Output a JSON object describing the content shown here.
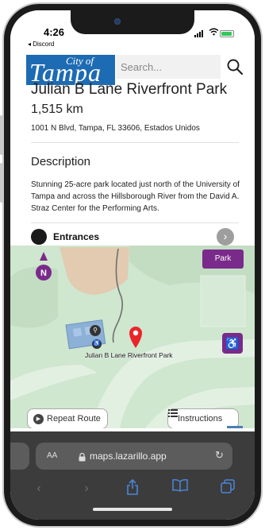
{
  "status": {
    "time": "4:26",
    "back_app": "◂ Discord"
  },
  "header": {
    "logo_city_text": "City of",
    "logo_name_text": "Tampa",
    "search_placeholder": "Search..."
  },
  "place": {
    "name": "Julian B Lane Riverfront Park",
    "distance": "1,515 km",
    "address": "1001 N Blvd, Tampa, FL 33606, Estados Unidos"
  },
  "description": {
    "heading": "Description",
    "text": "Stunning 25-acre park located just north of the University of Tampa and across the Hillsborough River from the David A. Straz Center for the Performing Arts."
  },
  "entrances": {
    "label": "Entrances",
    "arrow": "›"
  },
  "map": {
    "compass_letter": "N",
    "park_button": "Park",
    "marker_label": "Julian B Lane Riverfront Park",
    "repeat_route": "Repeat Route",
    "instructions": "Instructions",
    "accessibility_icon": "♿",
    "info_label": "i"
  },
  "browser": {
    "text_size_label": "AA",
    "url": "maps.lazarillo.app",
    "reload": "↻"
  },
  "colors": {
    "logo_blue": "#1d6bb3",
    "accent_purple": "#7a2a8a",
    "marker_red": "#e8262a",
    "map_green": "#cfe6cf",
    "safari_blue": "#4a86d8"
  }
}
